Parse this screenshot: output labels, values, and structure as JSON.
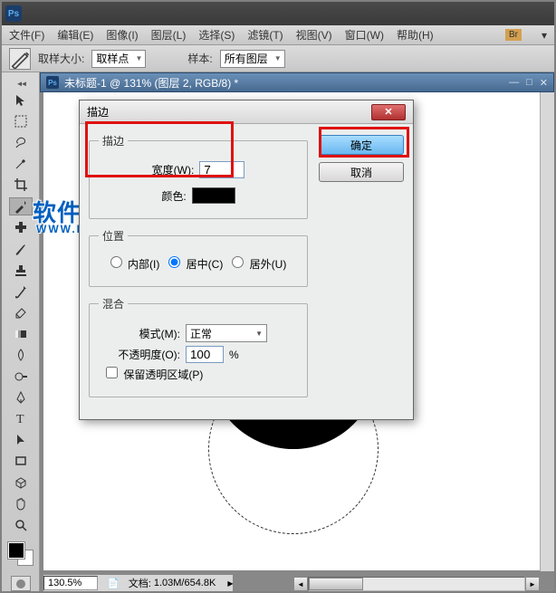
{
  "menu": {
    "file": "文件(F)",
    "edit": "编辑(E)",
    "image": "图像(I)",
    "layer": "图层(L)",
    "select": "选择(S)",
    "filter": "滤镜(T)",
    "view": "视图(V)",
    "window": "窗口(W)",
    "help": "帮助(H)",
    "br": "Br"
  },
  "options": {
    "sample_size_label": "取样大小:",
    "sample_size_value": "取样点",
    "sample_layers_label": "样本:",
    "sample_layers_value": "所有图层"
  },
  "document": {
    "title": "未标题-1 @ 131% (图层 2, RGB/8) *",
    "zoom": "130.5%",
    "doc_info_label": "文档:",
    "doc_info": "1.03M/654.8K"
  },
  "watermark": {
    "text": "软件自学网",
    "url": "WWW.RJZXW.COM"
  },
  "dialog": {
    "title": "描边",
    "ok": "确定",
    "cancel": "取消",
    "stroke_group": "描边",
    "width_label": "宽度(W):",
    "width_value": "7",
    "color_label": "颜色:",
    "position_group": "位置",
    "pos_inside": "内部(I)",
    "pos_center": "居中(C)",
    "pos_outside": "居外(U)",
    "blend_group": "混合",
    "mode_label": "模式(M):",
    "mode_value": "正常",
    "opacity_label": "不透明度(O):",
    "opacity_value": "100",
    "opacity_unit": "%",
    "preserve_trans": "保留透明区域(P)"
  }
}
